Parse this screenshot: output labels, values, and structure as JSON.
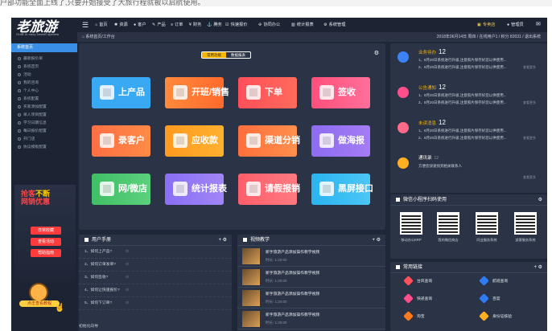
{
  "caption": "户部功能全面上线了,只要开始接受了大旅行程就被以启航使用。",
  "logo": {
    "text": "老旅游",
    "sub": "Gold & easy travel system"
  },
  "sidebar": {
    "header": "系统首页",
    "items": [
      "最新报价单",
      "系统首页",
      "活动",
      "我的咨询",
      "个人中心",
      "系统配置",
      "买家添加配置",
      "单人项目配置",
      "学习日期信息",
      "每日报价配置",
      "开门店",
      "协议模板配置"
    ]
  },
  "promo": {
    "title_a": "抢客",
    "title_b": "不断",
    "title_c": "网销优惠",
    "btn1": "日常收藏",
    "btn2": "查看活动",
    "btn3": "帮助指南",
    "mascot_label": "点击查看教程"
  },
  "topnav": {
    "items": [
      "首页",
      "资源",
      "客户",
      "产品",
      "订单",
      "财务",
      "腾务",
      "快速报价",
      "协同办公",
      "统计报表",
      "系统管理"
    ],
    "shop": "专卖店",
    "user": "管理员"
  },
  "breadcrumb": {
    "path": "系统首页/工作台",
    "info": "2018年06月14日 周四 / 在线用户1 / 积分 82031 / 退出系统"
  },
  "main": {
    "tab_a": "常用功能",
    "tab_b": "数据报表",
    "tiles": [
      {
        "label": "上产品",
        "color": "#3aa9f4"
      },
      {
        "label": "开班/销售",
        "color": "#ff7a3c"
      },
      {
        "label": "下单",
        "color": "#ff4f5a"
      },
      {
        "label": "签收",
        "color": "#ff5b8a"
      },
      {
        "label": "录客户",
        "color": "#ff6f45"
      },
      {
        "label": "应收款",
        "color": "#ff9a1f"
      },
      {
        "label": "渠道分销",
        "color": "#ff6f3c"
      },
      {
        "label": "做海报",
        "color": "#8d6cf0"
      },
      {
        "label": "网/微店",
        "color": "#43c06a"
      },
      {
        "label": "统计报表",
        "color": "#8a6ef5"
      },
      {
        "label": "请假报销",
        "color": "#ff5e6a"
      },
      {
        "label": "黑屏接口",
        "color": "#2ab4f0"
      }
    ]
  },
  "manual": {
    "title": "用户手册",
    "rows": [
      {
        "q": "1、如何上产品?",
        "a": "⊙"
      },
      {
        "q": "2、如何订单发单?",
        "a": "⊙"
      },
      {
        "q": "3、如何签收?",
        "a": "⊙"
      },
      {
        "q": "4、如何让快速报价?",
        "a": "⊙"
      },
      {
        "q": "5、如何下订单?",
        "a": "⊙"
      }
    ],
    "footer": "初始化向导"
  },
  "video": {
    "title": "视频教学",
    "rows": [
      {
        "t": "新手旅游产品添加操作教学视频",
        "d": "时长: 1:20:00"
      },
      {
        "t": "新手旅游产品添加操作教学视频",
        "d": "时长: 1:20:00"
      },
      {
        "t": "新手旅游产品添加操作教学视频",
        "d": "时长: 1:20:00"
      },
      {
        "t": "新手旅游产品添加操作教学视频",
        "d": "时长: 1:20:00"
      }
    ]
  },
  "notices": [
    {
      "title": "业务待办",
      "count": "12",
      "color": "#3b82f6",
      "l1": "1、8月20日系统进行升级,注意照片保存好您以供使用...",
      "l2": "2、8月20日系统进行升级,注意照片保存好您以供使用...",
      "more": "查看更多"
    },
    {
      "title": "公告通知",
      "count": "12",
      "color": "#ff4f8b",
      "l1": "1、8月20日系统进行升级,注意照片保存好您以供使用...",
      "l2": "2、8月20日系统进行升级,注意照片保存好您以供使用...",
      "more": "查看更多"
    },
    {
      "title": "未读消息",
      "count": "12",
      "color": "#ff6a88",
      "l1": "1、8月20日系统进行升级,注意照片保存好您以供使用...",
      "l2": "2、8月20日系统进行升级,注意照片保存好您以供使用...",
      "more": "查看更多"
    },
    {
      "title": "通讯录",
      "count": "12",
      "color": "#ffb020",
      "l1": "方便您快速找到相关联系人",
      "l2": "",
      "more": "查看更多"
    }
  ],
  "wechat": {
    "title": "微信小程序扫码使用",
    "labels": [
      "移动办公ERP",
      "我的微信商店",
      "同业服务系统",
      "游客服务系统"
    ]
  },
  "links": {
    "title": "常用链接",
    "items": [
      {
        "label": "台风查询",
        "color": "#ff4f5a"
      },
      {
        "label": "航班查询",
        "color": "#2f7bf0"
      },
      {
        "label": "快递查询",
        "color": "#ff4f8b"
      },
      {
        "label": "百度",
        "color": "#2f7bf0"
      },
      {
        "label": "淘宝",
        "color": "#ff7a1f"
      },
      {
        "label": "身份证核验",
        "color": "#ffb020"
      }
    ]
  }
}
